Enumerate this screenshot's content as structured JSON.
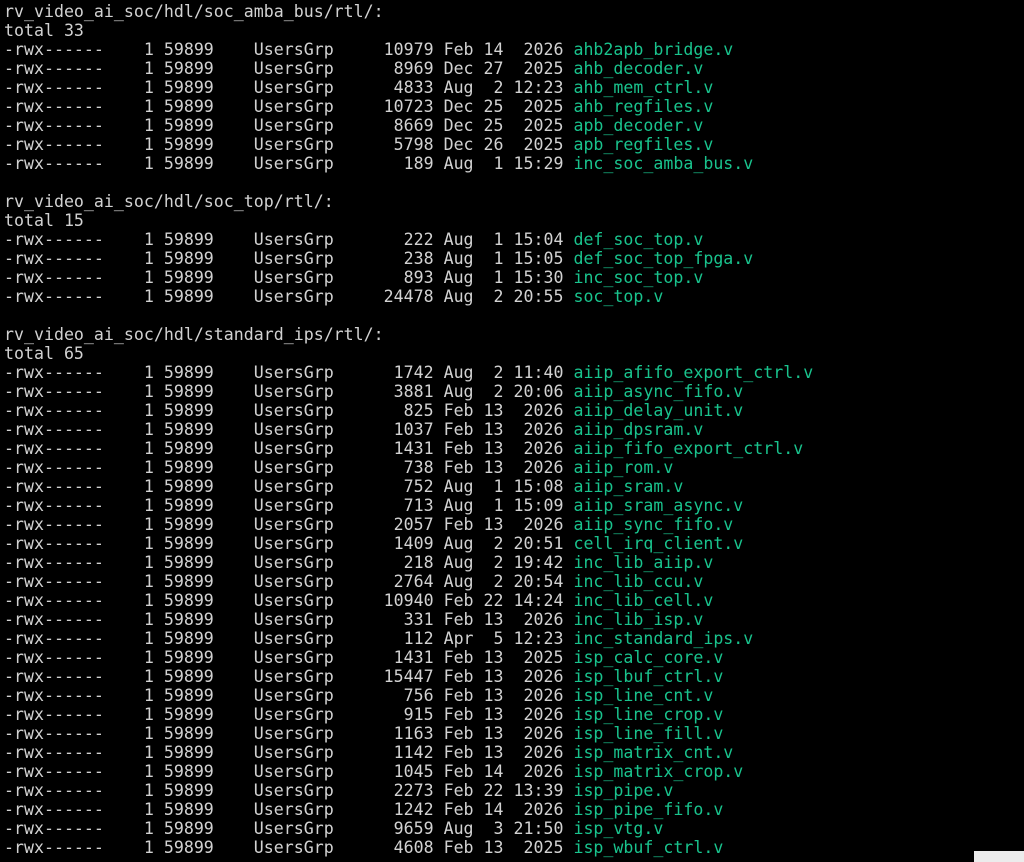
{
  "sections": [
    {
      "header": "rv_video_ai_soc/hdl/soc_amba_bus/rtl/:",
      "total": "total 33",
      "rows": [
        {
          "meta": "-rwx------    1 59899    UsersGrp     10979 Feb 14  2026 ",
          "file": "ahb2apb_bridge.v"
        },
        {
          "meta": "-rwx------    1 59899    UsersGrp      8969 Dec 27  2025 ",
          "file": "ahb_decoder.v"
        },
        {
          "meta": "-rwx------    1 59899    UsersGrp      4833 Aug  2 12:23 ",
          "file": "ahb_mem_ctrl.v"
        },
        {
          "meta": "-rwx------    1 59899    UsersGrp     10723 Dec 25  2025 ",
          "file": "ahb_regfiles.v"
        },
        {
          "meta": "-rwx------    1 59899    UsersGrp      8669 Dec 25  2025 ",
          "file": "apb_decoder.v"
        },
        {
          "meta": "-rwx------    1 59899    UsersGrp      5798 Dec 26  2025 ",
          "file": "apb_regfiles.v"
        },
        {
          "meta": "-rwx------    1 59899    UsersGrp       189 Aug  1 15:29 ",
          "file": "inc_soc_amba_bus.v"
        }
      ]
    },
    {
      "header": "rv_video_ai_soc/hdl/soc_top/rtl/:",
      "total": "total 15",
      "rows": [
        {
          "meta": "-rwx------    1 59899    UsersGrp       222 Aug  1 15:04 ",
          "file": "def_soc_top.v"
        },
        {
          "meta": "-rwx------    1 59899    UsersGrp       238 Aug  1 15:05 ",
          "file": "def_soc_top_fpga.v"
        },
        {
          "meta": "-rwx------    1 59899    UsersGrp       893 Aug  1 15:30 ",
          "file": "inc_soc_top.v"
        },
        {
          "meta": "-rwx------    1 59899    UsersGrp     24478 Aug  2 20:55 ",
          "file": "soc_top.v"
        }
      ]
    },
    {
      "header": "rv_video_ai_soc/hdl/standard_ips/rtl/:",
      "total": "total 65",
      "rows": [
        {
          "meta": "-rwx------    1 59899    UsersGrp      1742 Aug  2 11:40 ",
          "file": "aiip_afifo_export_ctrl.v"
        },
        {
          "meta": "-rwx------    1 59899    UsersGrp      3881 Aug  2 20:06 ",
          "file": "aiip_async_fifo.v"
        },
        {
          "meta": "-rwx------    1 59899    UsersGrp       825 Feb 13  2026 ",
          "file": "aiip_delay_unit.v"
        },
        {
          "meta": "-rwx------    1 59899    UsersGrp      1037 Feb 13  2026 ",
          "file": "aiip_dpsram.v"
        },
        {
          "meta": "-rwx------    1 59899    UsersGrp      1431 Feb 13  2026 ",
          "file": "aiip_fifo_export_ctrl.v"
        },
        {
          "meta": "-rwx------    1 59899    UsersGrp       738 Feb 13  2026 ",
          "file": "aiip_rom.v"
        },
        {
          "meta": "-rwx------    1 59899    UsersGrp       752 Aug  1 15:08 ",
          "file": "aiip_sram.v"
        },
        {
          "meta": "-rwx------    1 59899    UsersGrp       713 Aug  1 15:09 ",
          "file": "aiip_sram_async.v"
        },
        {
          "meta": "-rwx------    1 59899    UsersGrp      2057 Feb 13  2026 ",
          "file": "aiip_sync_fifo.v"
        },
        {
          "meta": "-rwx------    1 59899    UsersGrp      1409 Aug  2 20:51 ",
          "file": "cell_irq_client.v"
        },
        {
          "meta": "-rwx------    1 59899    UsersGrp       218 Aug  2 19:42 ",
          "file": "inc_lib_aiip.v"
        },
        {
          "meta": "-rwx------    1 59899    UsersGrp      2764 Aug  2 20:54 ",
          "file": "inc_lib_ccu.v"
        },
        {
          "meta": "-rwx------    1 59899    UsersGrp     10940 Feb 22 14:24 ",
          "file": "inc_lib_cell.v"
        },
        {
          "meta": "-rwx------    1 59899    UsersGrp       331 Feb 13  2026 ",
          "file": "inc_lib_isp.v"
        },
        {
          "meta": "-rwx------    1 59899    UsersGrp       112 Apr  5 12:23 ",
          "file": "inc_standard_ips.v"
        },
        {
          "meta": "-rwx------    1 59899    UsersGrp      1431 Feb 13  2025 ",
          "file": "isp_calc_core.v"
        },
        {
          "meta": "-rwx------    1 59899    UsersGrp     15447 Feb 13  2026 ",
          "file": "isp_lbuf_ctrl.v"
        },
        {
          "meta": "-rwx------    1 59899    UsersGrp       756 Feb 13  2026 ",
          "file": "isp_line_cnt.v"
        },
        {
          "meta": "-rwx------    1 59899    UsersGrp       915 Feb 13  2026 ",
          "file": "isp_line_crop.v"
        },
        {
          "meta": "-rwx------    1 59899    UsersGrp      1163 Feb 13  2026 ",
          "file": "isp_line_fill.v"
        },
        {
          "meta": "-rwx------    1 59899    UsersGrp      1142 Feb 13  2026 ",
          "file": "isp_matrix_cnt.v"
        },
        {
          "meta": "-rwx------    1 59899    UsersGrp      1045 Feb 14  2026 ",
          "file": "isp_matrix_crop.v"
        },
        {
          "meta": "-rwx------    1 59899    UsersGrp      2273 Feb 22 13:39 ",
          "file": "isp_pipe.v"
        },
        {
          "meta": "-rwx------    1 59899    UsersGrp      1242 Feb 14  2026 ",
          "file": "isp_pipe_fifo.v"
        },
        {
          "meta": "-rwx------    1 59899    UsersGrp      9659 Aug  3 21:50 ",
          "file": "isp_vtg.v"
        },
        {
          "meta": "-rwx------    1 59899    UsersGrp      4608 Feb 13  2025 ",
          "file": "isp_wbuf_ctrl.v"
        }
      ]
    }
  ],
  "colors": {
    "background": "#000000",
    "text": "#d2d2d2",
    "filename": "#19c38d"
  }
}
